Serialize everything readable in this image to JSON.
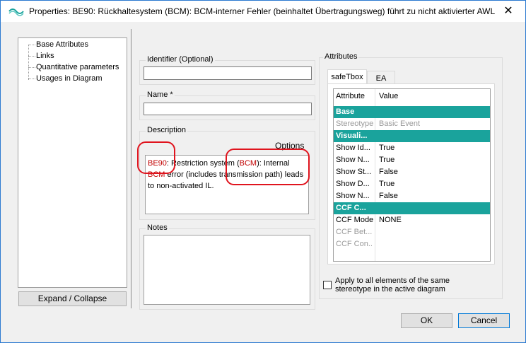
{
  "window": {
    "title": "Properties: BE90: Rückhaltesystem (BCM): BCM-interner Fehler (beinhaltet Übertragungsweg) führt zu nicht aktivierter AWL",
    "close_glyph": "✕"
  },
  "tree": {
    "items": [
      "Base Attributes",
      "Links",
      "Quantitative parameters",
      "Usages in Diagram"
    ]
  },
  "expand_collapse_label": "Expand / Collapse",
  "identifier": {
    "label": "Identifier (Optional)",
    "value": ""
  },
  "name": {
    "label": "Name *",
    "value": ""
  },
  "description": {
    "label": "Description",
    "options_label": "Options",
    "segments": {
      "s1": "BE90",
      "s2": ": Restriction system (",
      "s3": "BCM",
      "s4": "): Internal ",
      "s5": "BCM",
      "s6": " error (includes transmission path) leads to non-activated IL."
    }
  },
  "notes": {
    "label": "Notes",
    "value": ""
  },
  "attributes": {
    "label": "Attributes",
    "tabs": [
      "safeTbox",
      "EA"
    ],
    "grid_headers": [
      "Attribute",
      "Value"
    ],
    "rows": [
      {
        "attribute": "Base",
        "value": "",
        "kind": "category"
      },
      {
        "attribute": "Stereotype",
        "value": "Basic Event",
        "kind": "disabled"
      },
      {
        "attribute": "Visuali...",
        "value": "",
        "kind": "category"
      },
      {
        "attribute": "Show Id...",
        "value": "True",
        "kind": "normal"
      },
      {
        "attribute": "Show N...",
        "value": "True",
        "kind": "normal"
      },
      {
        "attribute": "Show St...",
        "value": "False",
        "kind": "normal"
      },
      {
        "attribute": "Show D...",
        "value": "True",
        "kind": "normal"
      },
      {
        "attribute": "Show N...",
        "value": "False",
        "kind": "normal"
      },
      {
        "attribute": "CCF C...",
        "value": "",
        "kind": "category"
      },
      {
        "attribute": "CCF Model",
        "value": "NONE",
        "kind": "normal"
      },
      {
        "attribute": "CCF Bet...",
        "value": "",
        "kind": "disabled"
      },
      {
        "attribute": "CCF Con...",
        "value": "",
        "kind": "disabled"
      }
    ],
    "apply_all_line1": "Apply to all elements of the same",
    "apply_all_line2": "stereotype in the active diagram"
  },
  "buttons": {
    "ok": "OK",
    "cancel": "Cancel"
  },
  "colors": {
    "category_bg": "#1aa39c",
    "annotation_red": "#e0141e",
    "title_border": "#2b79d0"
  }
}
